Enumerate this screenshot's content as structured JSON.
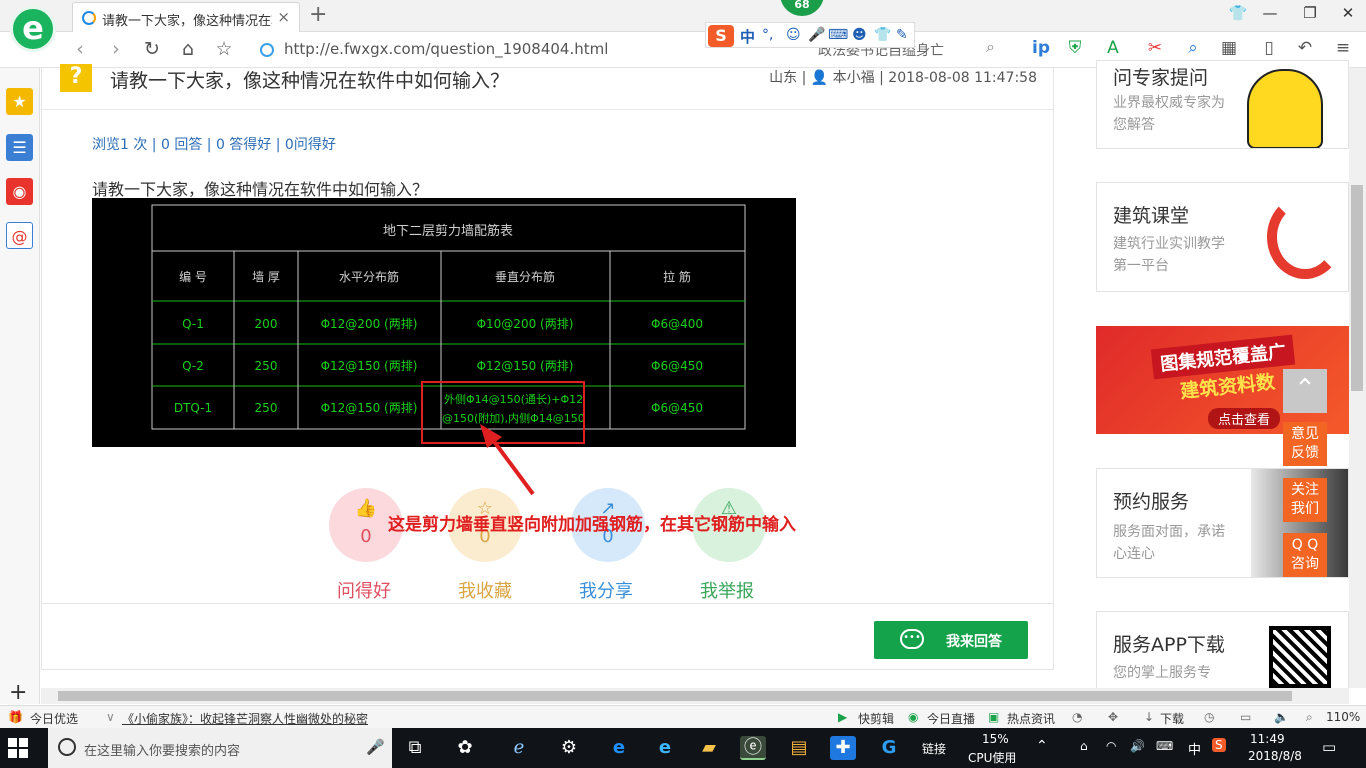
{
  "browser": {
    "tab_title": "请教一下大家，像这种情况在软件中如何输入？ - 工程问答",
    "tab_close": "×",
    "new_tab": "+",
    "badge": "68",
    "url": "http://e.fwxgx.com/question_1908404.html",
    "search_text": "政法委书记自缢身亡",
    "ime_zh": "中",
    "ime_badge": "S"
  },
  "question": {
    "title": "请教一下大家，像这种情况在软件中如何输入？",
    "location": "山东",
    "author": "本小福",
    "datetime": "2018-08-08 11:47:58",
    "stats": "浏览1 次 | 0 回答 | 0 答得好 | 0问得好",
    "body": "请教一下大家，像这种情况在软件中如何输入？"
  },
  "cad_table": {
    "title": "地下二层剪力墙配筋表",
    "headers": [
      "编  号",
      "墙  厚",
      "水平分布筋",
      "垂直分布筋",
      "拉    筋"
    ],
    "rows": [
      [
        "Q-1",
        "200",
        "Φ12@200  (两排)",
        "Φ10@200  (两排)",
        "Φ6@400"
      ],
      [
        "Q-2",
        "250",
        "Φ12@150  (两排)",
        "Φ12@150  (两排)",
        "Φ6@450"
      ],
      [
        "DTQ-1",
        "250",
        "Φ12@150  (两排)",
        "外侧Φ14@150(通长)+Φ12",
        "Φ6@450"
      ]
    ],
    "row3_extra": "@150(附加),内侧Φ14@150"
  },
  "annotation": "这是剪力墙垂直竖向附加加强钢筋，在其它钢筋中输入",
  "actions": [
    {
      "label": "问得好",
      "count": "0",
      "icon": "thumb-up-icon",
      "color": "#e04f5f",
      "bg": "#fbd9dd"
    },
    {
      "label": "我收藏",
      "count": "0",
      "icon": "star-icon",
      "color": "#d9a441",
      "bg": "#fbecd0"
    },
    {
      "label": "我分享",
      "count": "0",
      "icon": "share-icon",
      "color": "#3b8fd9",
      "bg": "#d5e9fb"
    },
    {
      "label": "我举报",
      "count": "",
      "icon": "warning-icon",
      "color": "#3aa55a",
      "bg": "#d8f2dd"
    }
  ],
  "answer_button": "我来回答",
  "right_panel": {
    "expert": {
      "title": "问专家提问",
      "sub": "业界最权威专家为您解答"
    },
    "course": {
      "title": "建筑课堂",
      "sub": "建筑行业实训教学第一平台"
    },
    "banner": {
      "line1": "图集规范覆盖广",
      "line2": "建筑资料数",
      "cta": "点击查看"
    },
    "booking": {
      "title": "预约服务",
      "sub": "服务面对面，承诺心连心"
    },
    "app": {
      "title": "服务APP下载",
      "sub": "您的掌上服务专"
    }
  },
  "float_buttons": [
    "意见\n反馈",
    "关注\n我们",
    "Q Q\n咨询"
  ],
  "statusbar": {
    "today": "今日优选",
    "news": "《小偷家族》：收起锋芒洞察人性幽微处的秘密",
    "kuaijianji": "快剪辑",
    "live": "今日直播",
    "hot": "热点资讯",
    "download": "下载",
    "zoom": "110%"
  },
  "taskbar": {
    "search_placeholder": "在这里输入你要搜索的内容",
    "link": "链接",
    "cpu_pct": "15%",
    "cpu_label": "CPU使用",
    "lang": "中",
    "time": "11:49",
    "date": "2018/8/8"
  },
  "colors": {
    "brand_green": "#1ab35e",
    "cad_green": "#19d019",
    "red": "#e02020",
    "answer_green": "#14a24a",
    "orange": "#f26522"
  }
}
